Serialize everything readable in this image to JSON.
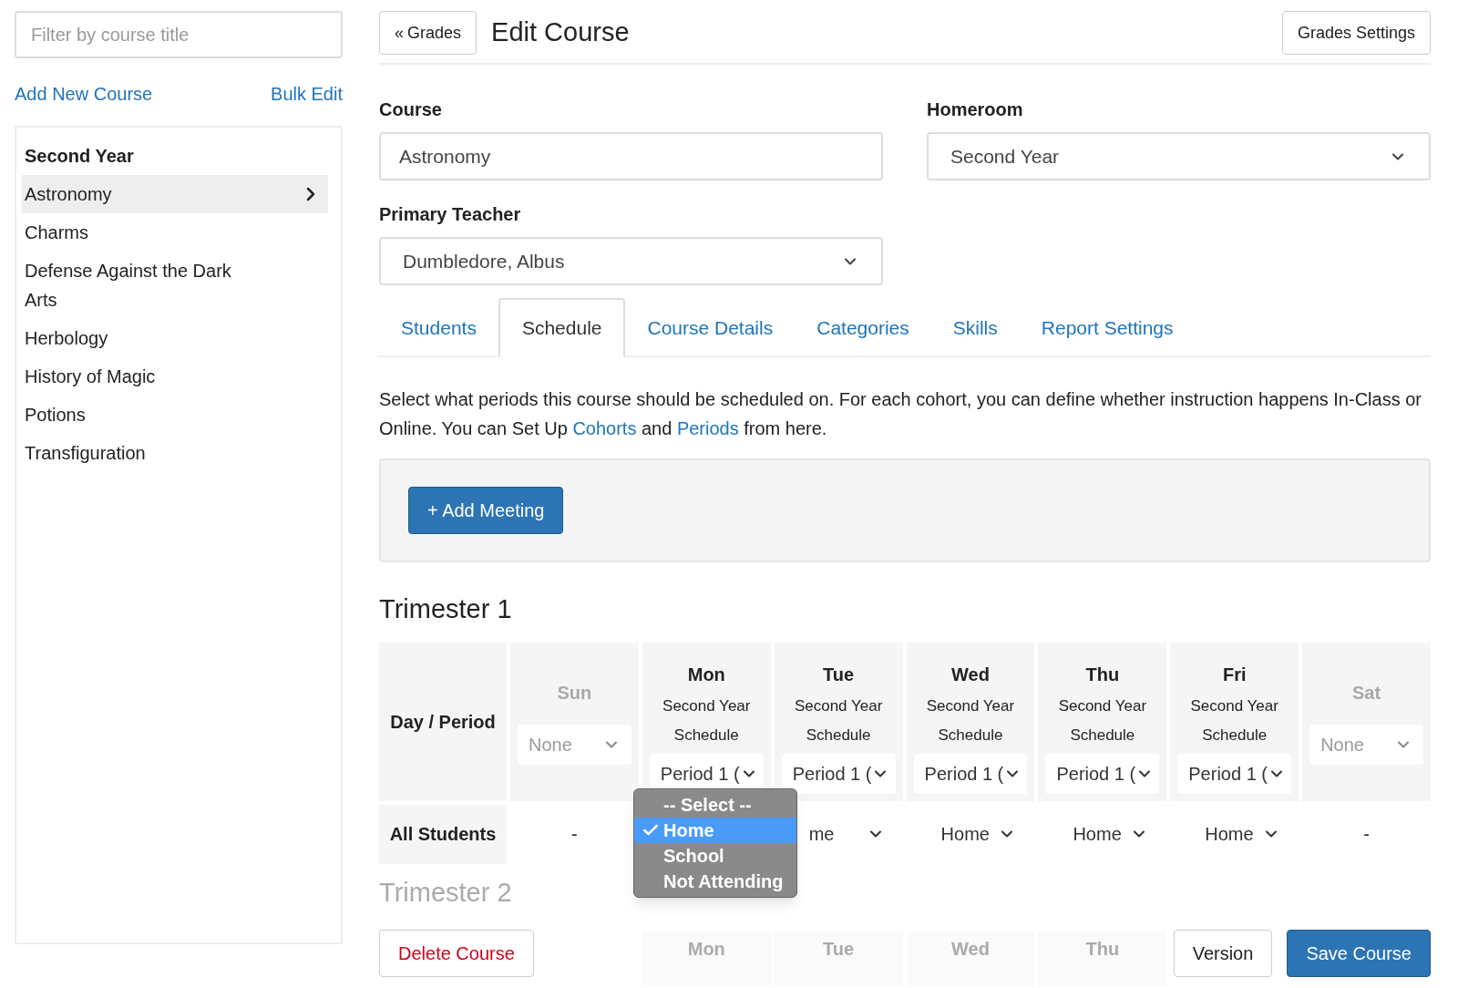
{
  "sidebar": {
    "filter": {
      "placeholder": "Filter by course title"
    },
    "links": [
      "Add New Course",
      "Bulk Edit"
    ],
    "group": "Second Year",
    "courses": [
      {
        "name": "Astronomy",
        "selected": true
      },
      {
        "name": "Charms",
        "selected": false
      },
      {
        "name": "Defense Against the Dark Arts",
        "selected": false
      },
      {
        "name": "Herbology",
        "selected": false
      },
      {
        "name": "History of Magic",
        "selected": false
      },
      {
        "name": "Potions",
        "selected": false
      },
      {
        "name": "Transfiguration",
        "selected": false
      }
    ]
  },
  "header": {
    "back_icon": "«",
    "back_label": "Grades",
    "title": "Edit Course",
    "settings_button": "Grades Settings"
  },
  "form": {
    "course": {
      "label": "Course",
      "value": "Astronomy"
    },
    "homeroom": {
      "label": "Homeroom",
      "value": "Second Year"
    },
    "teacher": {
      "label": "Primary Teacher",
      "value": "Dumbledore, Albus"
    }
  },
  "tabs": [
    {
      "label": "Students",
      "selected": false
    },
    {
      "label": "Schedule",
      "selected": true
    },
    {
      "label": "Course Details",
      "selected": false
    },
    {
      "label": "Categories",
      "selected": false
    },
    {
      "label": "Skills",
      "selected": false
    },
    {
      "label": "Report Settings",
      "selected": false
    }
  ],
  "description": [
    {
      "kind": "text",
      "text": "Select what periods this course should be scheduled on. For each cohort, you can define whether instruction happens In-Class or Online. You can Set Up "
    },
    {
      "kind": "link",
      "text": "Cohorts"
    },
    {
      "kind": "text",
      "text": " and "
    },
    {
      "kind": "link",
      "text": "Periods"
    },
    {
      "kind": "text",
      "text": " from here."
    }
  ],
  "add_meeting_button": "+ Add Meeting",
  "trimester_1": {
    "title": "Trimester 1",
    "corner": "Day / Period",
    "row_label": "All Students",
    "days": [
      {
        "day": "Sun",
        "disabled": true,
        "period": "None",
        "cohort": "-"
      },
      {
        "day": "Mon",
        "disabled": false,
        "schedule": "Second Year Schedule",
        "period": "Period 1 ("
      },
      {
        "day": "Tue",
        "disabled": false,
        "schedule": "Second Year Schedule",
        "period": "Period 1 (",
        "cohort": "me"
      },
      {
        "day": "Wed",
        "disabled": false,
        "schedule": "Second Year Schedule",
        "period": "Period 1 (",
        "cohort": "Home"
      },
      {
        "day": "Thu",
        "disabled": false,
        "schedule": "Second Year Schedule",
        "period": "Period 1 (",
        "cohort": "Home"
      },
      {
        "day": "Fri",
        "disabled": false,
        "schedule": "Second Year Schedule",
        "period": "Period 1 (",
        "cohort": "Home"
      },
      {
        "day": "Sat",
        "disabled": true,
        "period": "None",
        "cohort": "-"
      }
    ]
  },
  "cohort_menu": {
    "options": [
      {
        "label": "-- Select --",
        "selected": false
      },
      {
        "label": "Home",
        "selected": true
      },
      {
        "label": "School",
        "selected": false
      },
      {
        "label": "Not Attending",
        "selected": false
      }
    ]
  },
  "trimester_2": {
    "title": "Trimester 2",
    "days": [
      "Mon",
      "Tue",
      "Wed",
      "Thu"
    ]
  },
  "footer": {
    "delete": "Delete Course",
    "version": "Version",
    "save": "Save Course"
  }
}
